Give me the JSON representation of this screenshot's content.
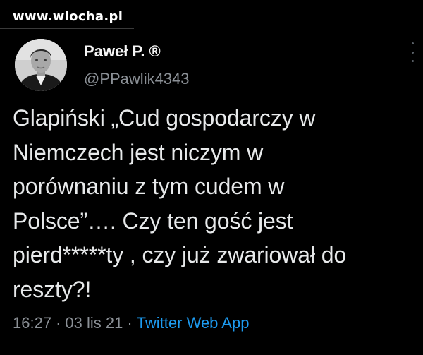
{
  "watermark": {
    "text": "www.wiocha.pl"
  },
  "author": {
    "display_name": "Paweł P. ®",
    "handle": "@PPawlik4343"
  },
  "tweet": {
    "lines": [
      "Glapiński „Cud gospodarczy w",
      "Niemczech jest niczym w",
      "porównaniu z tym cudem w",
      "Polsce”…. Czy ten gość jest",
      "pierd*****ty , czy już zwariował do",
      "reszty?!"
    ]
  },
  "meta": {
    "time": "16:27",
    "separator": "·",
    "date": "03 lis 21",
    "source": "Twitter Web App"
  },
  "colors": {
    "background": "#000000",
    "text": "#e7e9ea",
    "secondary": "#8b9096",
    "link": "#1d9bf0"
  },
  "icons": {
    "more": "more-options-icon",
    "avatar": "profile-photo"
  }
}
